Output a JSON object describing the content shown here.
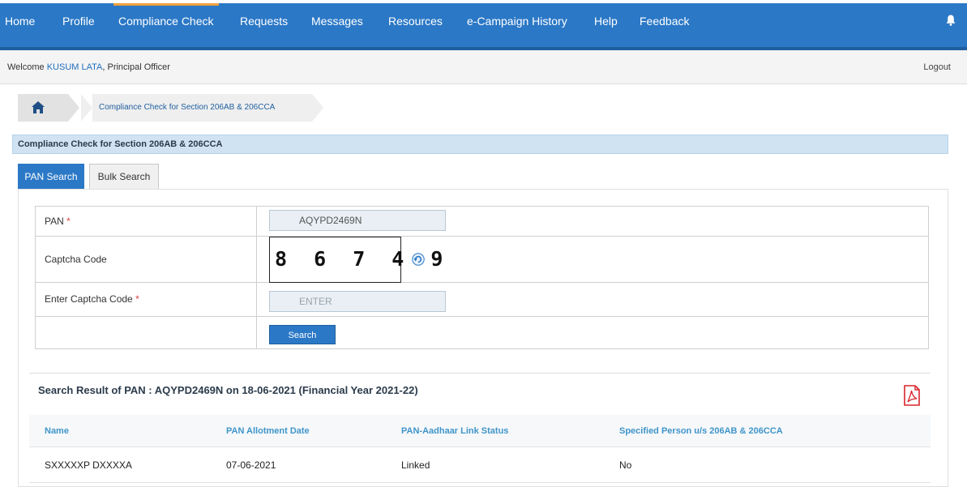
{
  "nav": {
    "items": [
      {
        "label": "Home"
      },
      {
        "label": "Profile"
      },
      {
        "label": "Compliance Check"
      },
      {
        "label": "Requests"
      },
      {
        "label": "Messages"
      },
      {
        "label": "Resources"
      },
      {
        "label": "e-Campaign History"
      },
      {
        "label": "Help"
      },
      {
        "label": "Feedback"
      }
    ],
    "active": "Compliance Check",
    "bell_icon": "bell-icon"
  },
  "welcome": {
    "prefix": "Welcome ",
    "user": "KUSUM LATA",
    "suffix": ", Principal Officer",
    "logout": "Logout"
  },
  "breadcrumb": {
    "home_icon": "home-icon",
    "current": "Compliance Check for Section 206AB & 206CCA"
  },
  "section": {
    "title": "Compliance Check for Section 206AB & 206CCA"
  },
  "tabs": [
    {
      "label": "PAN Search",
      "active": true
    },
    {
      "label": "Bulk Search",
      "active": false
    }
  ],
  "form": {
    "pan_label": "PAN",
    "pan_value": "AQYPD2469N",
    "captcha_label": "Captcha Code",
    "captcha_image_text": "8 6 7 4 9",
    "enter_captcha_label": "Enter Captcha Code",
    "enter_captcha_placeholder": "ENTER",
    "required_marker": "*",
    "search_button": "Search"
  },
  "result": {
    "title": "Search Result of PAN : AQYPD2469N on 18-06-2021 (Financial Year 2021-22)",
    "columns": [
      "Name",
      "PAN Allotment Date",
      "PAN-Aadhaar Link Status",
      "Specified Person u/s 206AB & 206CCA"
    ],
    "rows": [
      [
        "SXXXXXP DXXXXA",
        "07-06-2021",
        "Linked",
        "No"
      ]
    ]
  },
  "colors": {
    "nav_bg": "#2b78c6",
    "accent": "#f0a040",
    "header_bg": "#cfe3f3",
    "column_header": "#3f95c9",
    "pdf_red": "#d9262b"
  }
}
